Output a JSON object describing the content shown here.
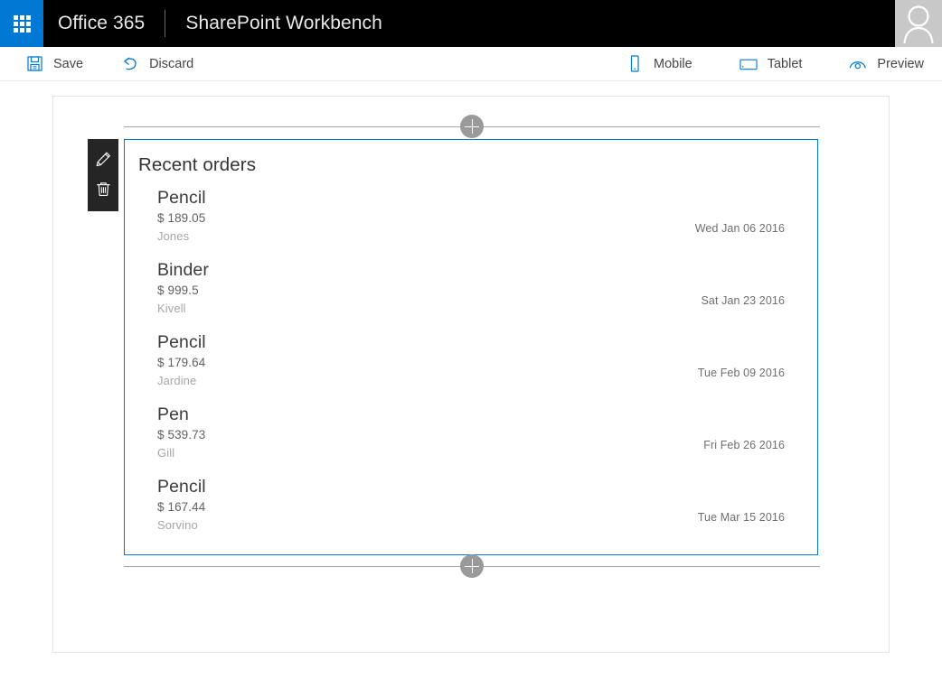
{
  "suite": {
    "waffle_label": "app-launcher",
    "brand": "Office 365",
    "sub_brand": "SharePoint Workbench",
    "avatar_label": "user-avatar"
  },
  "command_bar": {
    "left": [
      {
        "icon": "save-icon",
        "label": "Save"
      },
      {
        "icon": "undo-icon",
        "label": "Discard"
      }
    ],
    "right": [
      {
        "icon": "mobile-icon",
        "label": "Mobile"
      },
      {
        "icon": "tablet-icon",
        "label": "Tablet"
      },
      {
        "icon": "eye-icon",
        "label": "Preview"
      }
    ]
  },
  "canvas": {
    "add_zone_top_label": "Add a new web part",
    "add_zone_bottom_label": "Add a new web part"
  },
  "webpart": {
    "title": "Recent orders",
    "toolbar": [
      {
        "icon": "edit-pencil-icon",
        "label": "Edit web part"
      },
      {
        "icon": "trash-icon",
        "label": "Delete web part"
      }
    ],
    "orders": [
      {
        "name": "Pencil",
        "amount": "$ 189.05",
        "customer": "Jones",
        "date": "Wed Jan 06 2016"
      },
      {
        "name": "Binder",
        "amount": "$ 999.5",
        "customer": "Kivell",
        "date": "Sat Jan 23 2016"
      },
      {
        "name": "Pencil",
        "amount": "$ 179.64",
        "customer": "Jardine",
        "date": "Tue Feb 09 2016"
      },
      {
        "name": "Pen",
        "amount": "$ 539.73",
        "customer": "Gill",
        "date": "Fri Feb 26 2016"
      },
      {
        "name": "Pencil",
        "amount": "$ 167.44",
        "customer": "Sorvino",
        "date": "Tue Mar 15 2016"
      }
    ]
  },
  "colors": {
    "accent": "#0078d4",
    "suite_bar": "#000000",
    "webpart_border": "#0078d4",
    "toolbar_dark": "#252525",
    "add_button": "#9a9a9a"
  }
}
